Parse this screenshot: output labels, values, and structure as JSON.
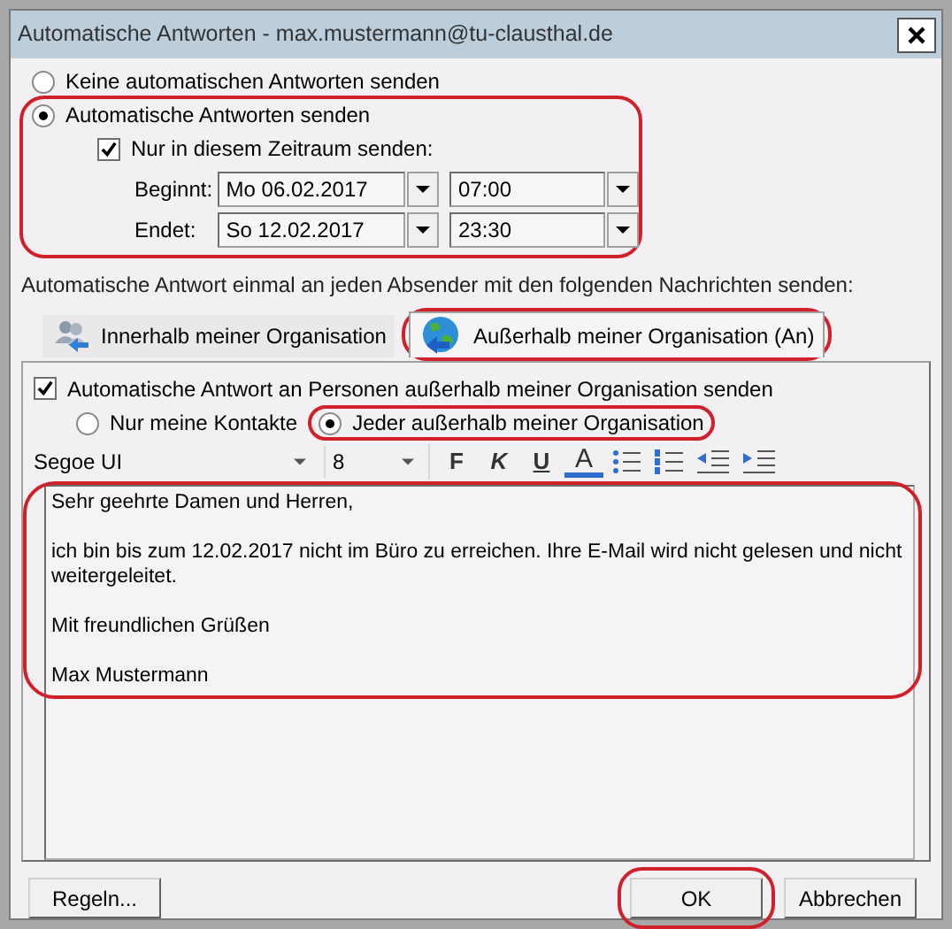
{
  "window": {
    "title": "Automatische Antworten - max.mustermann@tu-clausthal.de"
  },
  "reply_mode": [
    {
      "label": "Keine automatischen Antworten senden",
      "selected": false
    },
    {
      "label": "Automatische Antworten senden",
      "selected": true
    }
  ],
  "auto_section": {
    "highlighted": true
  },
  "time_range": {
    "label": "Nur in diesem Zeitraum senden:",
    "checked": true,
    "rows": [
      {
        "label": "Beginnt:",
        "date": "Mo 06.02.2017",
        "time": "07:00"
      },
      {
        "label": "Endet:",
        "date": "So 12.02.2017",
        "time": "23:30"
      }
    ]
  },
  "instruction": "Automatische Antwort einmal an jeden Absender mit den folgenden Nachrichten senden:",
  "tabs": [
    {
      "label": "Innerhalb meiner Organisation",
      "selected": false,
      "highlighted": false,
      "kind": "people"
    },
    {
      "label": "Außerhalb meiner Organisation (An)",
      "selected": true,
      "highlighted": true,
      "kind": "globe"
    }
  ],
  "external": {
    "label": "Automatische Antwort an Personen außerhalb meiner Organisation senden",
    "checked": true
  },
  "audience": [
    {
      "label": "Nur meine Kontakte",
      "selected": false,
      "highlighted": false
    },
    {
      "label": "Jeder außerhalb meiner Organisation",
      "selected": true,
      "highlighted": true
    }
  ],
  "toolbar": {
    "font": "Segoe UI",
    "size": "8",
    "buttons": [
      {
        "kind": "bold",
        "label": "F"
      },
      {
        "kind": "italic",
        "label": "K"
      },
      {
        "kind": "underline",
        "label": "U"
      },
      {
        "kind": "color",
        "label": "A"
      },
      {
        "kind": "bullets"
      },
      {
        "kind": "numbering"
      },
      {
        "kind": "outdent"
      },
      {
        "kind": "indent"
      }
    ]
  },
  "message": {
    "highlighted": true,
    "paragraphs": [
      "Sehr geehrte Damen und Herren,",
      "ich bin bis zum 12.02.2017 nicht im Büro zu erreichen. Ihre E-Mail wird nicht gelesen und nicht weitergeleitet.",
      "Mit freundlichen Grüßen",
      "Max Mustermann"
    ]
  },
  "buttons": [
    {
      "label": "Regeln...",
      "highlighted": false
    },
    {
      "label": "OK",
      "highlighted": true
    },
    {
      "label": "Abbrechen",
      "highlighted": false
    }
  ]
}
